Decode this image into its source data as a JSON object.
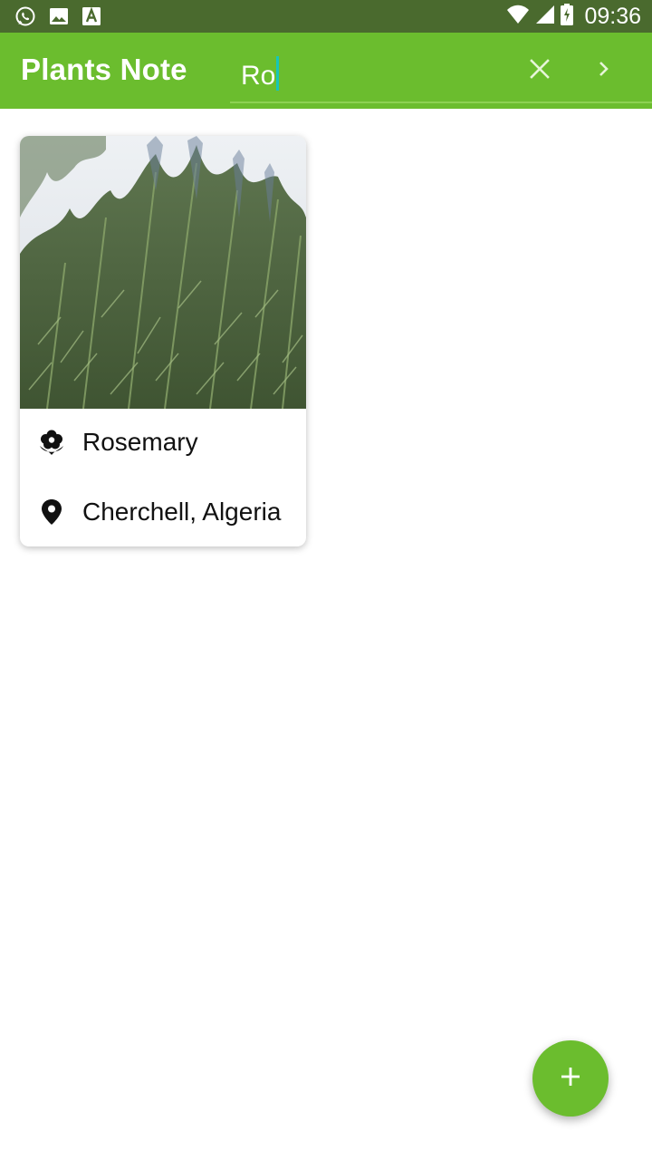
{
  "status_bar": {
    "time": "09:36",
    "icons": [
      "whatsapp-icon",
      "image-icon",
      "font-a-icon",
      "wifi-icon",
      "signal-icon",
      "battery-charging-icon"
    ],
    "background": "#4a6a2e"
  },
  "app_bar": {
    "title": "Plants Note",
    "search_value": "Ro",
    "clear_icon": "close-icon",
    "go_icon": "chevron-right-icon",
    "background": "#6bbd2e"
  },
  "cards": [
    {
      "name": "Rosemary",
      "location": "Cherchell, Algeria",
      "name_icon": "flower-icon",
      "location_icon": "location-pin-icon"
    }
  ],
  "fab": {
    "icon": "plus-icon",
    "color": "#6bbd2e"
  }
}
